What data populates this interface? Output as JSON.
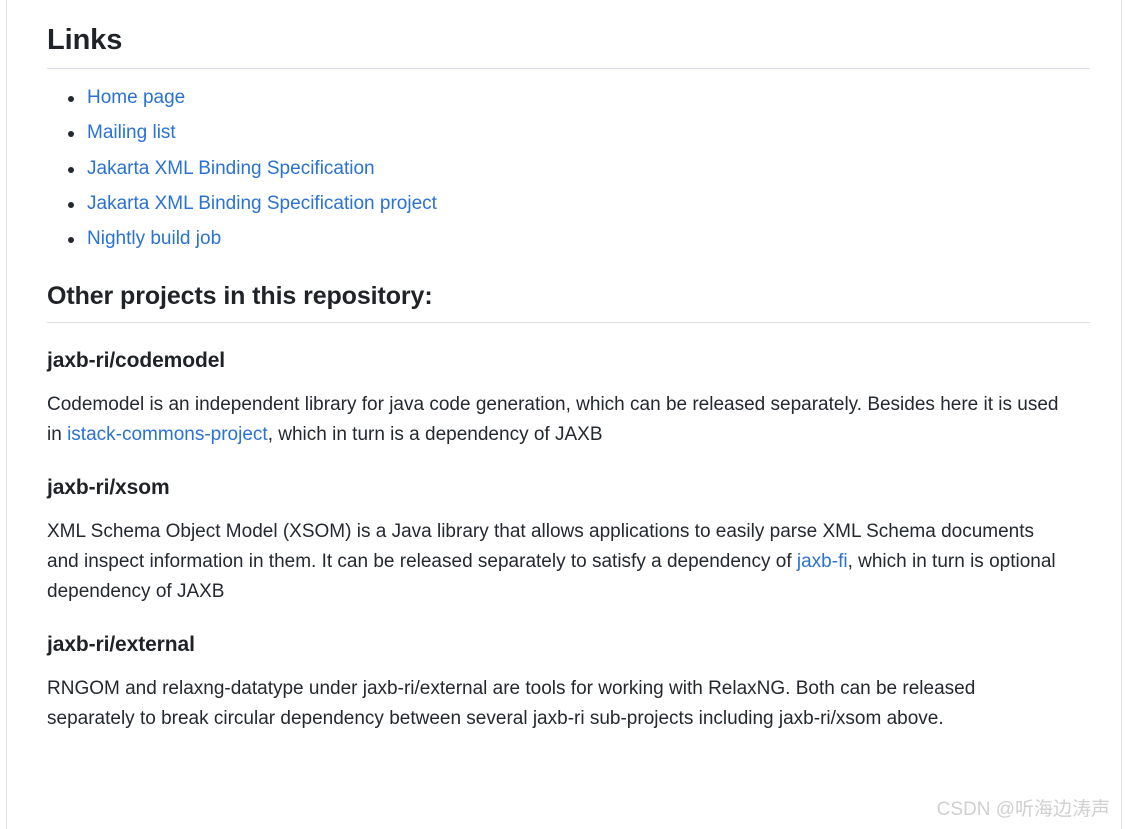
{
  "links_section": {
    "heading": "Links",
    "items": [
      {
        "label": "Home page"
      },
      {
        "label": "Mailing list"
      },
      {
        "label": "Jakarta XML Binding Specification"
      },
      {
        "label": "Jakarta XML Binding Specification project"
      },
      {
        "label": "Nightly build job"
      }
    ]
  },
  "other_projects_section": {
    "heading": "Other projects in this repository:",
    "projects": [
      {
        "title": "jaxb-ri/codemodel",
        "desc_before": "Codemodel is an independent library for java code generation, which can be released separately. Besides here it is used in ",
        "link": "istack-commons-project",
        "desc_after": ", which in turn is a dependency of JAXB"
      },
      {
        "title": "jaxb-ri/xsom",
        "desc_before": "XML Schema Object Model (XSOM) is a Java library that allows applications to easily parse XML Schema documents and inspect information in them. It can be released separately to satisfy a dependency of ",
        "link": "jaxb-fi",
        "desc_after": ", which in turn is optional dependency of JAXB"
      },
      {
        "title": "jaxb-ri/external",
        "desc_before": "RNGOM and relaxng-datatype under jaxb-ri/external are tools for working with RelaxNG. Both can be released separately to break circular dependency between several jaxb-ri sub-projects including jaxb-ri/xsom above.",
        "link": "",
        "desc_after": ""
      }
    ]
  },
  "watermark": {
    "text": "CSDN @听海边涛声"
  },
  "colors": {
    "link": "#2a72d4",
    "text": "#24292f",
    "rule": "#d8dee4",
    "watermark": "#d0d0d0"
  }
}
